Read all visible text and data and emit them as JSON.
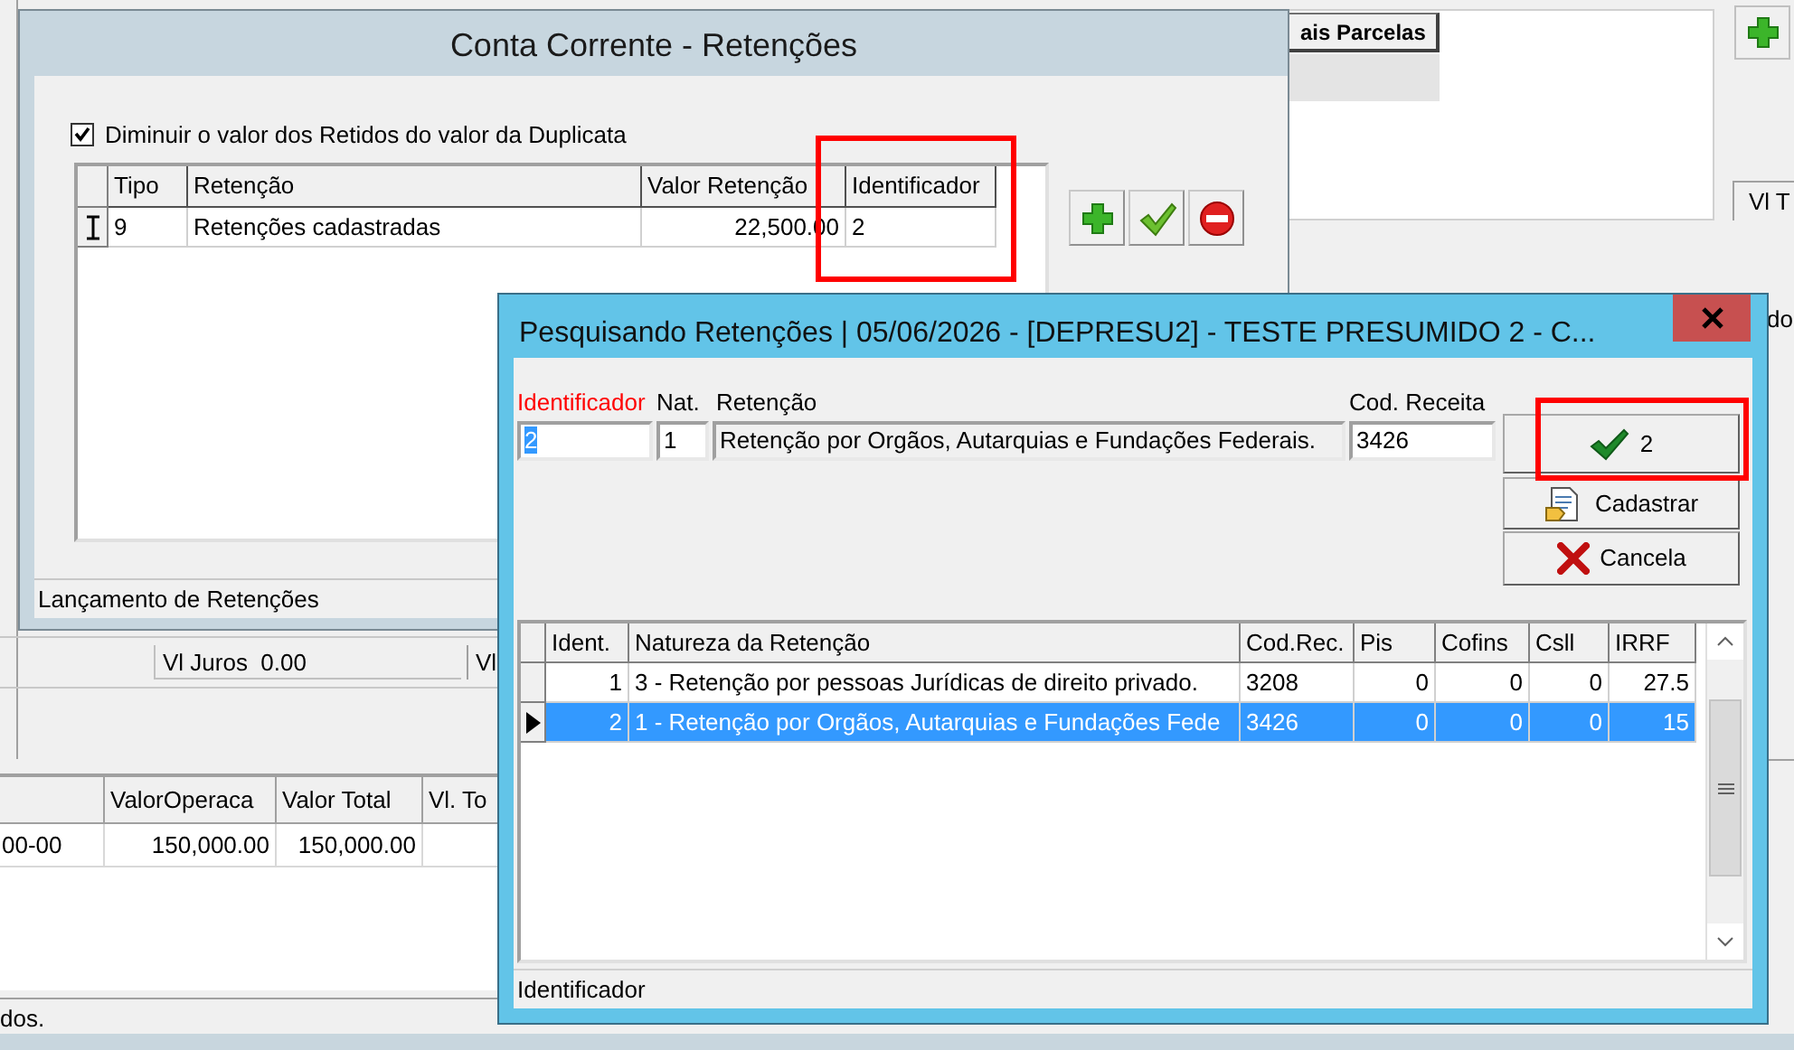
{
  "background_window": {
    "tab_label": "ais Parcelas",
    "side_label": "Vl T",
    "juros_label": "Vl Juros",
    "juros_value": "0.00",
    "juros_label_2": "Vl",
    "right_header": "do",
    "grid": {
      "columns": [
        "ValorOperaca",
        "Valor Total",
        "Vl. To"
      ],
      "rows": [
        {
          "column_1": "00-00",
          "valor_operacao": "150,000.00",
          "valor_total": "150,000.00"
        }
      ]
    },
    "status_text": "dos."
  },
  "retencoes_window": {
    "title": "Conta Corrente - Retenções",
    "checkbox": {
      "label": "Diminuir o valor dos Retidos do valor da Duplicata",
      "checked": true
    },
    "grid": {
      "columns": [
        "Tipo",
        "Retenção",
        "Valor Retenção",
        "Identificador"
      ],
      "rows": [
        {
          "tipo": "9",
          "retencao": "Retenções cadastradas",
          "valor": "22,500.00",
          "identificador": "2",
          "editing": true
        }
      ]
    },
    "status": "Lançamento de Retenções"
  },
  "search_dialog": {
    "title": "Pesquisando Retenções |  05/06/2026 - [DEPRESU2] - TESTE PRESUMIDO 2 - C...",
    "fields": [
      {
        "label": "Identificador",
        "value": "2",
        "required": true,
        "text_selected": true,
        "readonly": false
      },
      {
        "label": "Nat.",
        "value": "1",
        "required": false,
        "text_selected": false,
        "readonly": false
      },
      {
        "label": "Retenção",
        "value": "Retenção por Orgãos, Autarquias e Fundações Federais.",
        "required": false,
        "text_selected": false,
        "readonly": true
      },
      {
        "label": "Cod. Receita",
        "value": "3426",
        "required": false,
        "text_selected": false,
        "readonly": false
      }
    ],
    "buttons": [
      {
        "kind": "confirm",
        "label": "2"
      },
      {
        "kind": "register",
        "label": "Cadastrar"
      },
      {
        "kind": "cancel",
        "label": "Cancela"
      }
    ],
    "grid": {
      "columns": [
        "Ident.",
        "Natureza da Retenção",
        "Cod.Rec.",
        "Pis",
        "Cofins",
        "Csll",
        "IRRF"
      ],
      "rows": [
        {
          "cells": [
            "1",
            "3 - Retenção por pessoas Jurídicas de direito privado.",
            "3208",
            "0",
            "0",
            "0",
            "27.5"
          ],
          "selected": false
        },
        {
          "cells": [
            "2",
            "1 - Retenção por Orgãos, Autarquias e Fundações Fede",
            "3426",
            "0",
            "0",
            "0",
            "15"
          ],
          "selected": true
        }
      ]
    },
    "status": "Identificador"
  }
}
